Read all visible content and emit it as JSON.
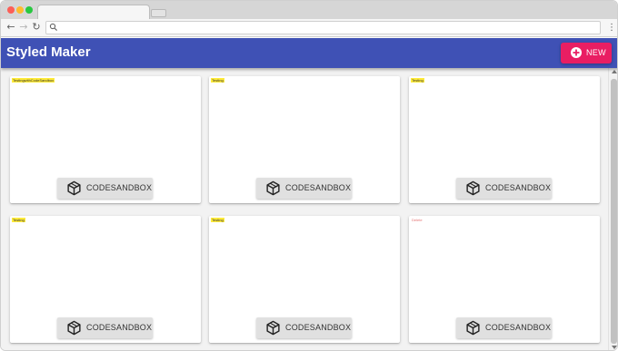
{
  "browser": {
    "menu_icon": "⋮"
  },
  "appbar": {
    "title": "Styled Maker",
    "new_button_label": "NEW",
    "color": "#3f51b5",
    "accent": "#e91e63"
  },
  "cards": [
    {
      "tag": "TestingwithCodeSandbox",
      "button_label": "CODESANDBOX"
    },
    {
      "tag": "Testing",
      "button_label": "CODESANDBOX"
    },
    {
      "tag": "Testing",
      "button_label": "CODESANDBOX"
    },
    {
      "tag": "Testing",
      "button_label": "CODESANDBOX"
    },
    {
      "tag": "Testing",
      "button_label": "CODESANDBOX"
    },
    {
      "tag": "Delete",
      "button_label": "CODESANDBOX"
    }
  ],
  "icons": {
    "back": "back-arrow-icon",
    "forward": "forward-arrow-icon",
    "reload": "reload-icon",
    "search": "search-icon",
    "menu": "kebab-menu-icon",
    "new": "plus-circle-icon",
    "codesandbox": "codesandbox-cube-icon"
  }
}
